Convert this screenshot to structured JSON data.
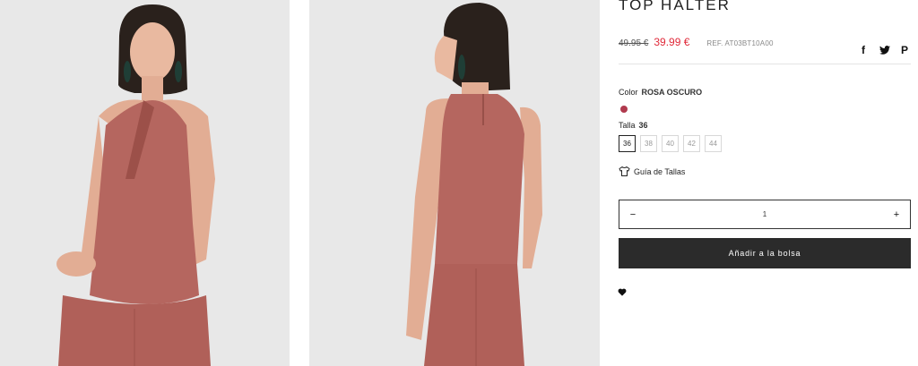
{
  "product": {
    "title": "TOP HALTER",
    "old_price": "49.95 €",
    "price": "39.99 €",
    "ref": "REF. AT03BT10A00"
  },
  "share": {
    "facebook": "f",
    "twitter": "🐦",
    "pinterest": "P"
  },
  "color": {
    "label": "Color",
    "value": "ROSA OSCURO",
    "swatch_hex": "#b03a4e"
  },
  "size": {
    "label": "Talla",
    "value": "36",
    "options": [
      "36",
      "38",
      "40",
      "42",
      "44"
    ],
    "selected": "36"
  },
  "size_guide": {
    "label": "Guía de Tallas",
    "icon": "tshirt-icon"
  },
  "quantity": {
    "minus": "−",
    "value": "1",
    "plus": "+"
  },
  "cart": {
    "add_label": "Añadir a la bolsa"
  },
  "wishlist": {
    "icon": "heart-icon"
  },
  "colors": {
    "accent_price": "#e02a3a",
    "button_bg": "#2b2b2b",
    "garment": "#b5665f"
  }
}
